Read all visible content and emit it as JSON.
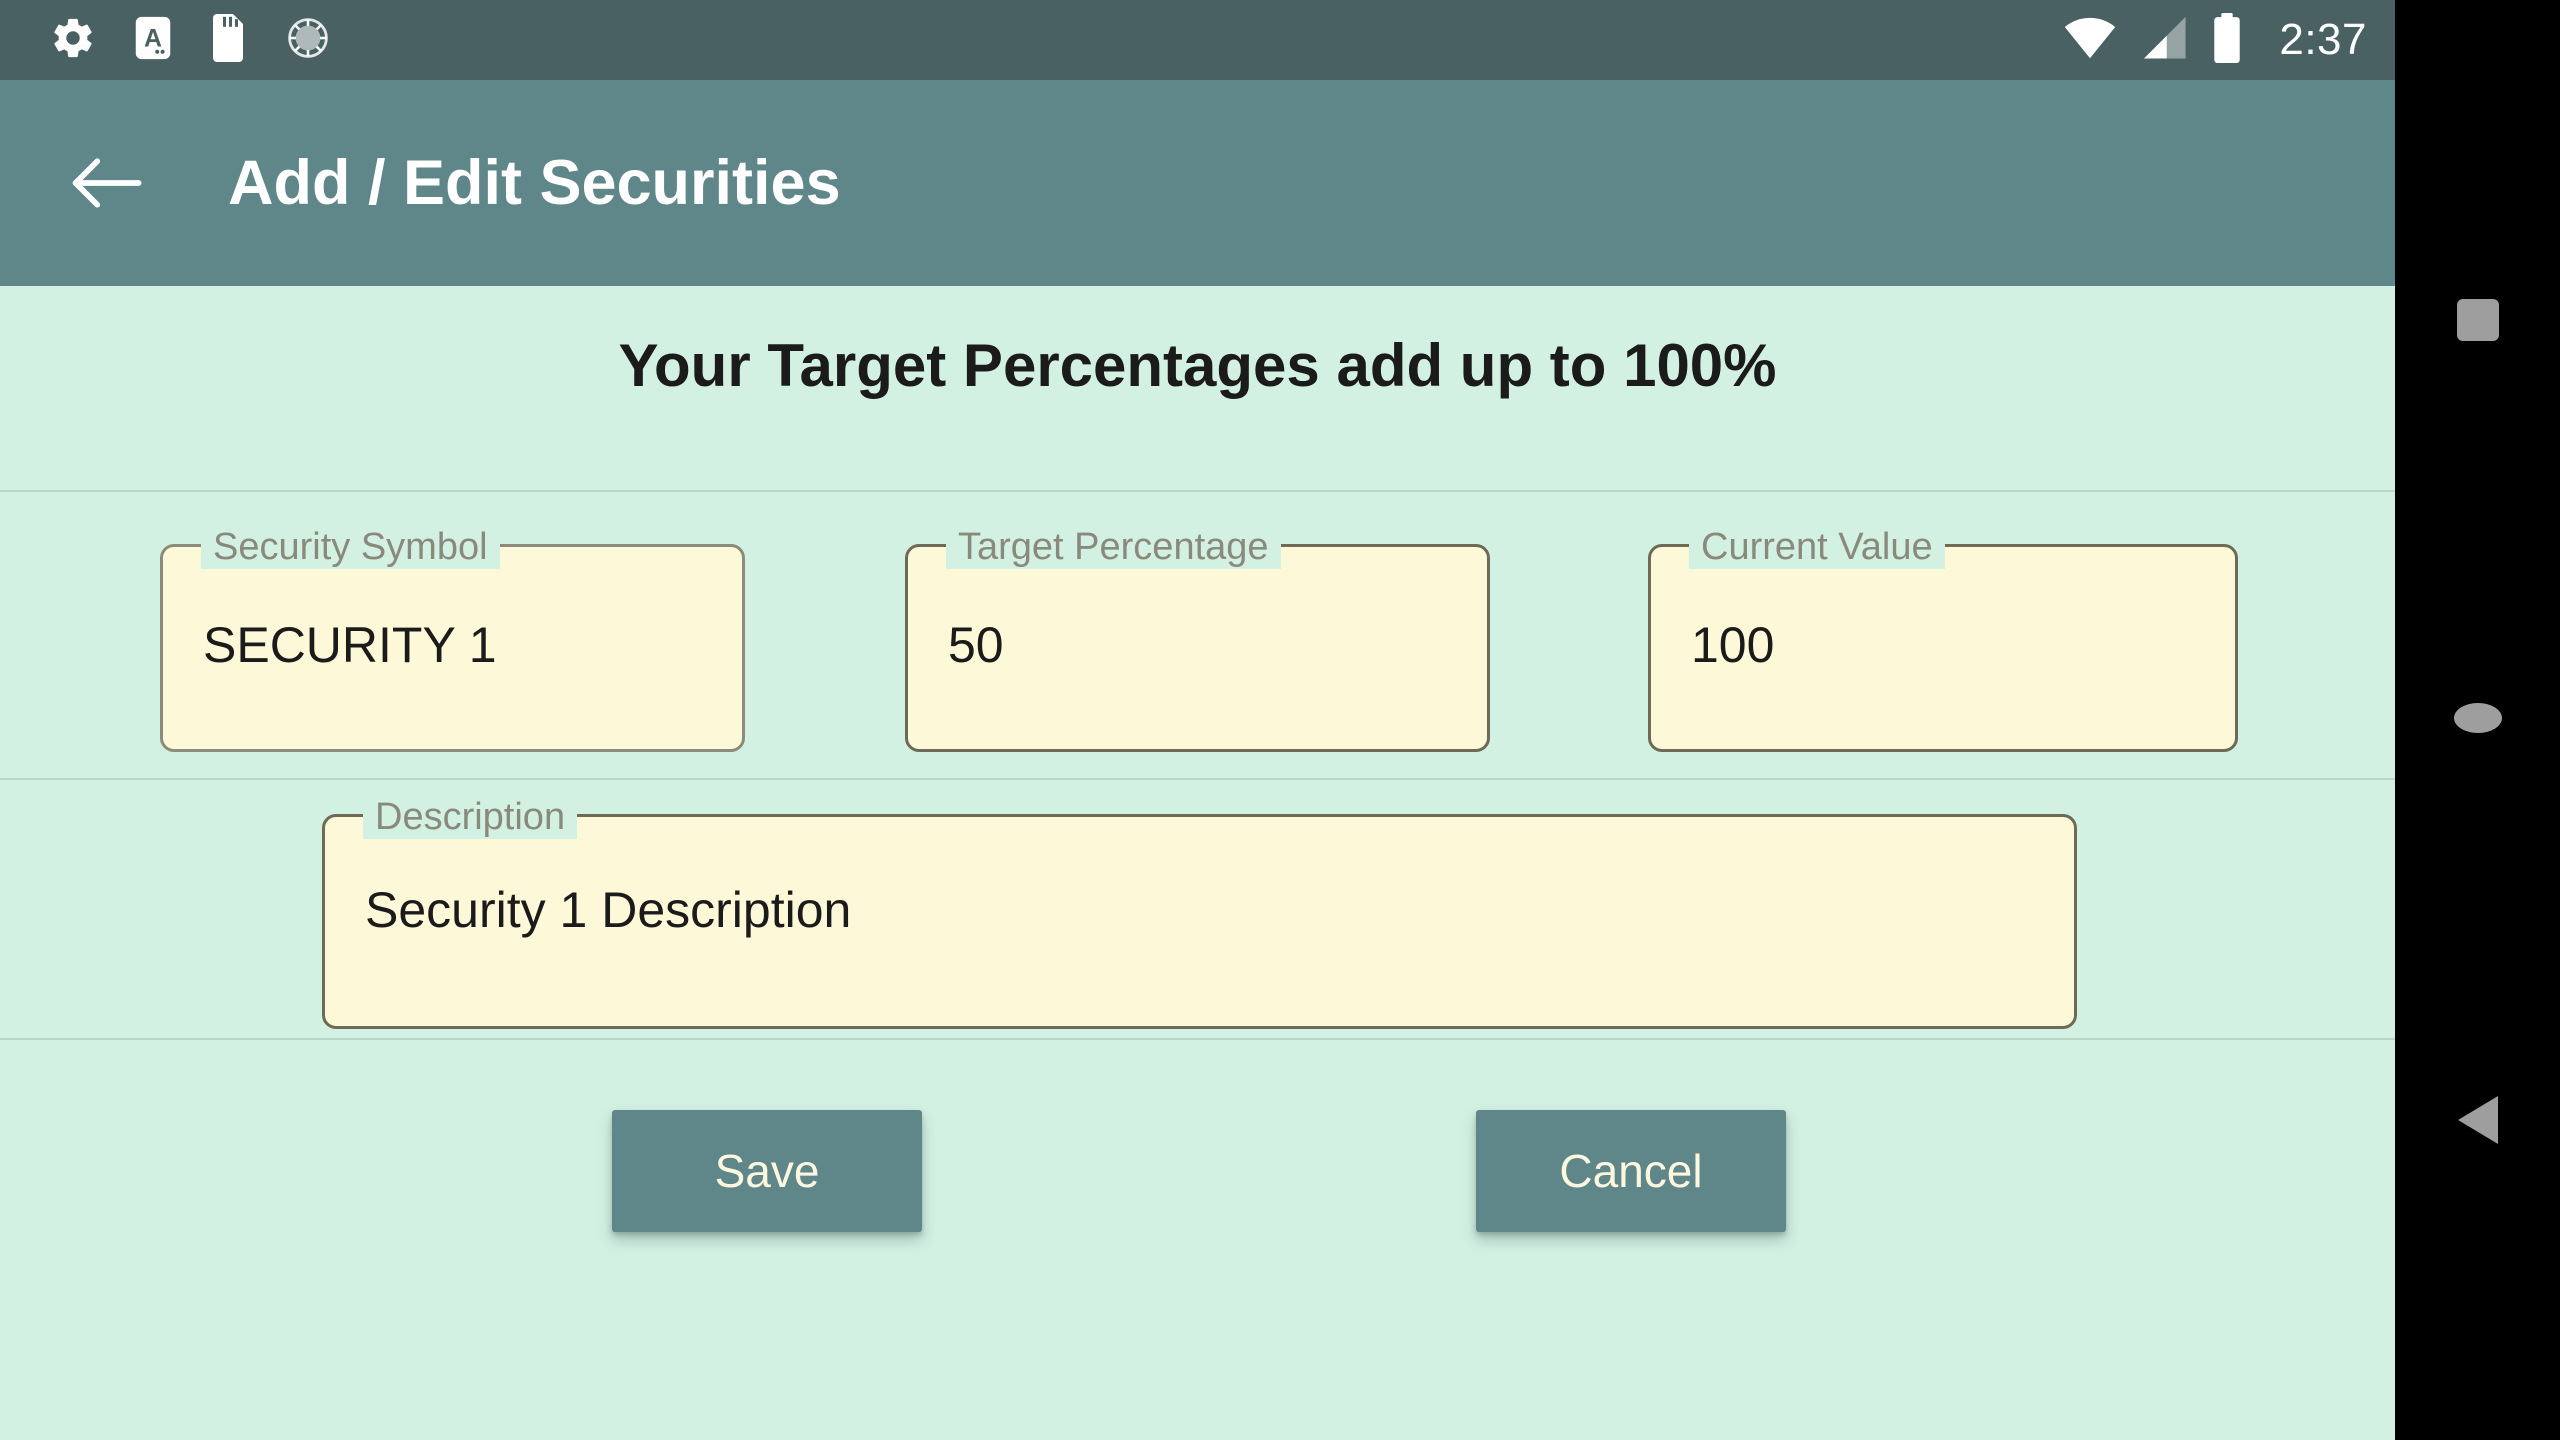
{
  "status_bar": {
    "icons": [
      "gear-icon",
      "letter-a-badge-icon",
      "sd-card-icon",
      "sync-spinner-icon"
    ],
    "wifi": "wifi-icon",
    "cellular": "cellular-signal-icon",
    "battery": "battery-full-icon",
    "clock": "2:37",
    "background_color": "#4A6163"
  },
  "toolbar": {
    "back_icon": "arrow-back-icon",
    "title": "Add / Edit Securities",
    "background_color": "#5F8688",
    "text_color": "#FFFFFF"
  },
  "content": {
    "headline": "Your Target Percentages add up to 100%",
    "background_color": "#D3F1E3",
    "fields": [
      {
        "label": "Security Symbol",
        "value": "SECURITY 1"
      },
      {
        "label": "Target Percentage",
        "value": "50"
      },
      {
        "label": "Current Value",
        "value": "100"
      },
      {
        "label": "Description",
        "value": "Security 1 Description"
      }
    ],
    "field_fill_color": "#FDF9D8",
    "field_border_color": "#6D6A55"
  },
  "actions": {
    "save_label": "Save",
    "cancel_label": "Cancel",
    "button_color": "#5F8688",
    "button_text_color": "#FDF7E0"
  },
  "navigation_bar": {
    "recents_label": "Overview",
    "home_label": "Home",
    "back_label": "Back",
    "background_color": "#000000",
    "key_color": "#9E9E9E"
  }
}
